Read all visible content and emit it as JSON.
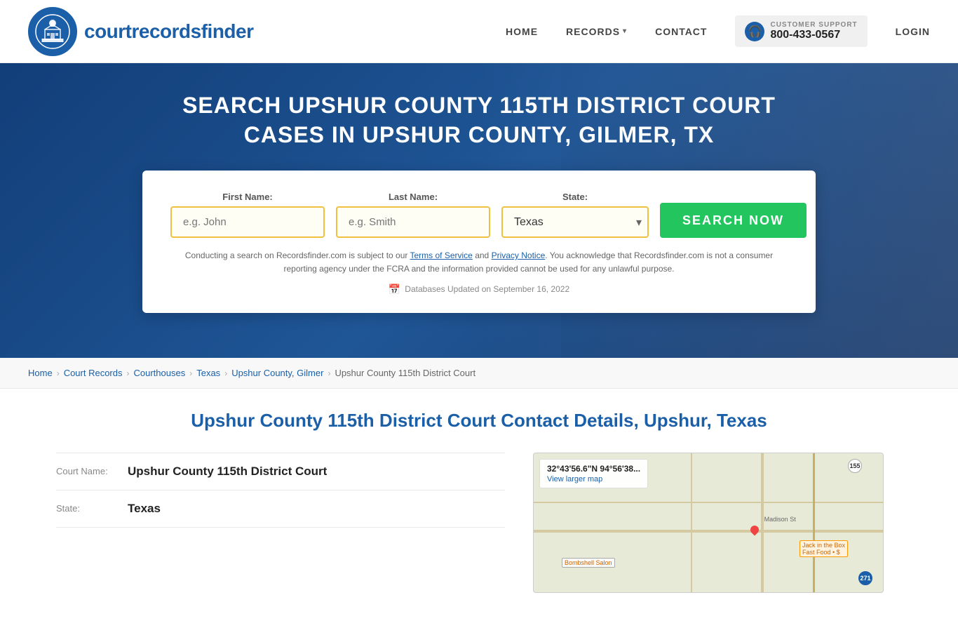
{
  "header": {
    "logo_text_light": "courtrecords",
    "logo_text_bold": "finder",
    "nav": {
      "home": "HOME",
      "records": "RECORDS",
      "contact": "CONTACT",
      "login": "LOGIN"
    },
    "support": {
      "label": "CUSTOMER SUPPORT",
      "phone": "800-433-0567"
    }
  },
  "hero": {
    "title": "SEARCH UPSHUR COUNTY 115TH DISTRICT COURT CASES IN UPSHUR COUNTY, GILMER, TX",
    "search": {
      "first_name_label": "First Name:",
      "last_name_label": "Last Name:",
      "state_label": "State:",
      "first_name_placeholder": "e.g. John",
      "last_name_placeholder": "e.g. Smith",
      "state_value": "Texas",
      "search_button": "SEARCH NOW",
      "disclaimer": "Conducting a search on Recordsfinder.com is subject to our Terms of Service and Privacy Notice. You acknowledge that Recordsfinder.com is not a consumer reporting agency under the FCRA and the information provided cannot be used for any unlawful purpose.",
      "db_updated": "Databases Updated on September 16, 2022"
    }
  },
  "breadcrumb": {
    "items": [
      {
        "label": "Home",
        "href": "#"
      },
      {
        "label": "Court Records",
        "href": "#"
      },
      {
        "label": "Courthouses",
        "href": "#"
      },
      {
        "label": "Texas",
        "href": "#"
      },
      {
        "label": "Upshur County, Gilmer",
        "href": "#"
      },
      {
        "label": "Upshur County 115th District Court",
        "href": "#"
      }
    ]
  },
  "main": {
    "page_title": "Upshur County 115th District Court Contact Details, Upshur, Texas",
    "court_details": {
      "court_name_label": "Court Name:",
      "court_name_value": "Upshur County 115th District Court",
      "state_label": "State:",
      "state_value": "Texas"
    },
    "map": {
      "coords": "32°43'56.6\"N 94°56'38...",
      "view_larger": "View larger map",
      "road1": "Madison St",
      "route_num": "155",
      "store1": "Jack in the Box Fast Food • $",
      "store2": "Bombshell Salon",
      "route2": "271 N"
    }
  },
  "colors": {
    "primary_blue": "#1a5fa8",
    "hero_bg_start": "#0f3c78",
    "green_btn": "#22c55e",
    "yellow_border": "#f0c040"
  }
}
